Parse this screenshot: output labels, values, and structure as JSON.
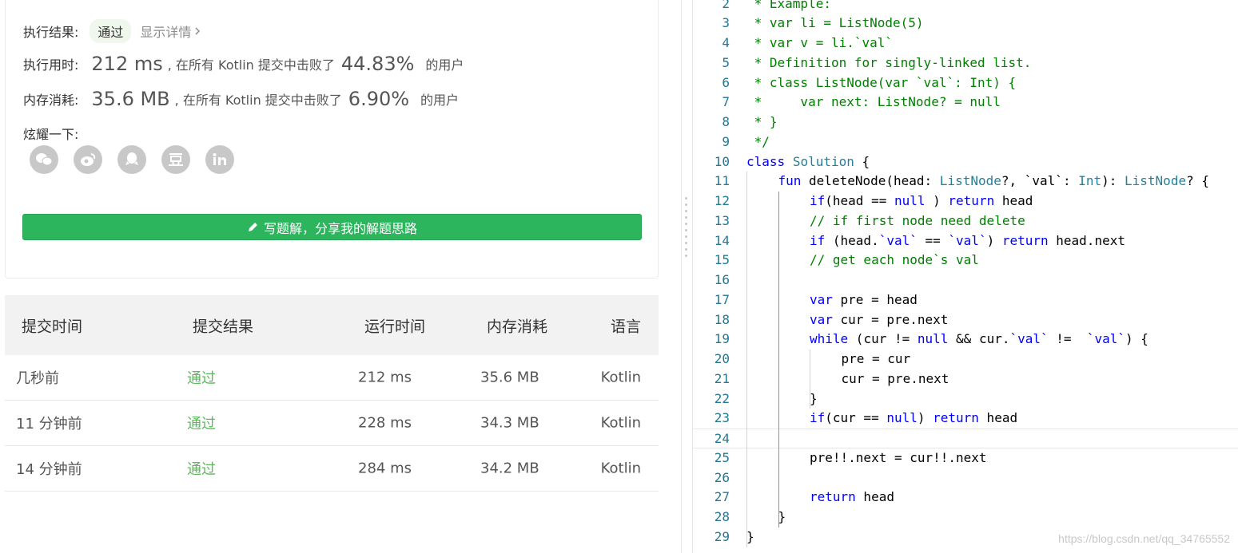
{
  "result": {
    "status_label": "执行结果:",
    "status_value": "通过",
    "detail_link": "显示详情",
    "runtime_label": "执行用时:",
    "runtime_value": "212 ms",
    "runtime_text": ", 在所有 Kotlin 提交中击败了",
    "runtime_pct": "44.83%",
    "runtime_users": "的用户",
    "memory_label": "内存消耗:",
    "memory_value": "35.6 MB",
    "memory_text": ", 在所有 Kotlin 提交中击败了",
    "memory_pct": "6.90%",
    "memory_users": "的用户",
    "share_label": "炫耀一下:",
    "share_icons": [
      "wechat-icon",
      "weibo-icon",
      "qq-icon",
      "douban-icon",
      "linkedin-icon"
    ],
    "write_button": "写题解，分享我的解题思路"
  },
  "submissions": {
    "headers": [
      "提交时间",
      "提交结果",
      "运行时间",
      "内存消耗",
      "语言"
    ],
    "rows": [
      [
        "几秒前",
        "通过",
        "212 ms",
        "35.6 MB",
        "Kotlin"
      ],
      [
        "11 分钟前",
        "通过",
        "228 ms",
        "34.3 MB",
        "Kotlin"
      ],
      [
        "14 分钟前",
        "通过",
        "284 ms",
        "34.2 MB",
        "Kotlin"
      ]
    ]
  },
  "editor": {
    "active_line": 24,
    "lines": [
      {
        "n": "2",
        "indent": 0,
        "tokens": [
          [
            "cm",
            " * Example:"
          ]
        ]
      },
      {
        "n": "3",
        "indent": 0,
        "tokens": [
          [
            "cm",
            " * var li = ListNode(5)"
          ]
        ]
      },
      {
        "n": "4",
        "indent": 0,
        "tokens": [
          [
            "cm",
            " * var v = li.`val`"
          ]
        ]
      },
      {
        "n": "5",
        "indent": 0,
        "tokens": [
          [
            "cm",
            " * Definition for singly-linked list."
          ]
        ]
      },
      {
        "n": "6",
        "indent": 0,
        "tokens": [
          [
            "cm",
            " * class ListNode(var `val`: Int) {"
          ]
        ]
      },
      {
        "n": "7",
        "indent": 0,
        "tokens": [
          [
            "cm",
            " *     var next: ListNode? = null"
          ]
        ]
      },
      {
        "n": "8",
        "indent": 0,
        "tokens": [
          [
            "cm",
            " * }"
          ]
        ]
      },
      {
        "n": "9",
        "indent": 0,
        "tokens": [
          [
            "cm",
            " */"
          ]
        ]
      },
      {
        "n": "10",
        "indent": 0,
        "tokens": [
          [
            "kw",
            "class"
          ],
          [
            "pl",
            " "
          ],
          [
            "ty",
            "Solution"
          ],
          [
            "pl",
            " {"
          ]
        ]
      },
      {
        "n": "11",
        "indent": 1,
        "tokens": [
          [
            "kw",
            "fun"
          ],
          [
            "pl",
            " deleteNode(head: "
          ],
          [
            "ty",
            "ListNode"
          ],
          [
            "pl",
            "?, "
          ],
          [
            "pl",
            "`val`"
          ],
          [
            "pl",
            ": "
          ],
          [
            "ty",
            "Int"
          ],
          [
            "pl",
            "): "
          ],
          [
            "ty",
            "ListNode"
          ],
          [
            "pl",
            "? {"
          ]
        ]
      },
      {
        "n": "12",
        "indent": 2,
        "tokens": [
          [
            "kw",
            "if"
          ],
          [
            "pl",
            "(head == "
          ],
          [
            "kw",
            "null"
          ],
          [
            "pl",
            " ) "
          ],
          [
            "kw",
            "return"
          ],
          [
            "pl",
            " head"
          ]
        ]
      },
      {
        "n": "13",
        "indent": 2,
        "tokens": [
          [
            "cm",
            "// if first node need delete"
          ]
        ]
      },
      {
        "n": "14",
        "indent": 2,
        "tokens": [
          [
            "kw",
            "if"
          ],
          [
            "pl",
            " (head."
          ],
          [
            "kw",
            "`val`"
          ],
          [
            "pl",
            " == "
          ],
          [
            "kw",
            "`val`"
          ],
          [
            "pl",
            ") "
          ],
          [
            "kw",
            "return"
          ],
          [
            "pl",
            " head.next"
          ]
        ]
      },
      {
        "n": "15",
        "indent": 2,
        "tokens": [
          [
            "cm",
            "// get each node`s val"
          ]
        ]
      },
      {
        "n": "16",
        "indent": 2,
        "tokens": []
      },
      {
        "n": "17",
        "indent": 2,
        "tokens": [
          [
            "kw",
            "var"
          ],
          [
            "pl",
            " pre = head"
          ]
        ]
      },
      {
        "n": "18",
        "indent": 2,
        "tokens": [
          [
            "kw",
            "var"
          ],
          [
            "pl",
            " cur = pre.next"
          ]
        ]
      },
      {
        "n": "19",
        "indent": 2,
        "tokens": [
          [
            "kw",
            "while"
          ],
          [
            "pl",
            " (cur != "
          ],
          [
            "kw",
            "null"
          ],
          [
            "pl",
            " && cur."
          ],
          [
            "kw",
            "`val`"
          ],
          [
            "pl",
            " !=  "
          ],
          [
            "kw",
            "`val`"
          ],
          [
            "pl",
            ") {"
          ]
        ]
      },
      {
        "n": "20",
        "indent": 3,
        "tokens": [
          [
            "pl",
            "pre = cur"
          ]
        ]
      },
      {
        "n": "21",
        "indent": 3,
        "tokens": [
          [
            "pl",
            "cur = pre.next"
          ]
        ]
      },
      {
        "n": "22",
        "indent": 2,
        "tokens": [
          [
            "pl",
            "}"
          ]
        ]
      },
      {
        "n": "23",
        "indent": 2,
        "tokens": [
          [
            "kw",
            "if"
          ],
          [
            "pl",
            "(cur == "
          ],
          [
            "kw",
            "null"
          ],
          [
            "pl",
            ") "
          ],
          [
            "kw",
            "return"
          ],
          [
            "pl",
            " head"
          ]
        ]
      },
      {
        "n": "24",
        "indent": 2,
        "tokens": []
      },
      {
        "n": "25",
        "indent": 2,
        "tokens": [
          [
            "pl",
            "pre!!.next = cur!!.next"
          ]
        ]
      },
      {
        "n": "26",
        "indent": 2,
        "tokens": []
      },
      {
        "n": "27",
        "indent": 2,
        "tokens": [
          [
            "kw",
            "return"
          ],
          [
            "pl",
            " head"
          ]
        ]
      },
      {
        "n": "28",
        "indent": 1,
        "tokens": [
          [
            "pl",
            "}"
          ]
        ]
      },
      {
        "n": "29",
        "indent": 0,
        "tokens": [
          [
            "pl",
            "}"
          ]
        ]
      }
    ],
    "watermark": "https://blog.csdn.net/qq_34765552"
  },
  "colors": {
    "accent_green": "#2db55d",
    "pass_green": "#5cb85c",
    "keyword": "#0000ff",
    "comment": "#008000",
    "type": "#267f99",
    "line_number": "#237893"
  }
}
